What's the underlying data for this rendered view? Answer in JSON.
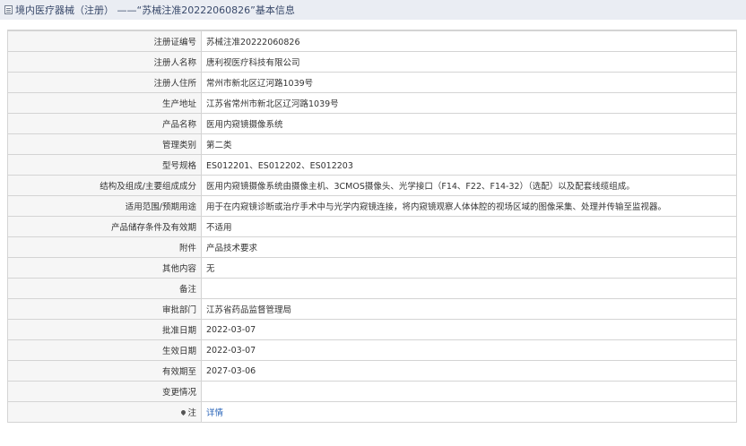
{
  "header": {
    "title": "境内医疗器械（注册） ——“苏械注准20222060826”基本信息"
  },
  "rows": [
    {
      "label": "注册证编号",
      "value": "苏械注准20222060826"
    },
    {
      "label": "注册人名称",
      "value": "唐利视医疗科技有限公司"
    },
    {
      "label": "注册人住所",
      "value": "常州市新北区辽河路1039号"
    },
    {
      "label": "生产地址",
      "value": "江苏省常州市新北区辽河路1039号"
    },
    {
      "label": "产品名称",
      "value": "医用内窥镜摄像系统"
    },
    {
      "label": "管理类别",
      "value": "第二类"
    },
    {
      "label": "型号规格",
      "value": "ES012201、ES012202、ES012203"
    },
    {
      "label": "结构及组成/主要组成成分",
      "value": "医用内窥镜摄像系统由摄像主机、3CMOS摄像头、光学接口（F14、F22、F14-32）（选配）以及配套线缆组成。"
    },
    {
      "label": "适用范围/预期用途",
      "value": "用于在内窥镜诊断或治疗手术中与光学内窥镜连接，将内窥镜观察人体体腔的视场区域的图像采集、处理并传输至监视器。"
    },
    {
      "label": "产品储存条件及有效期",
      "value": "不适用"
    },
    {
      "label": "附件",
      "value": "产品技术要求"
    },
    {
      "label": "其他内容",
      "value": "无"
    },
    {
      "label": "备注",
      "value": ""
    },
    {
      "label": "审批部门",
      "value": "江苏省药品监督管理局"
    },
    {
      "label": "批准日期",
      "value": "2022-03-07"
    },
    {
      "label": "生效日期",
      "value": "2022-03-07"
    },
    {
      "label": "有效期至",
      "value": "2027-03-06"
    },
    {
      "label": "变更情况",
      "value": ""
    }
  ],
  "note_row": {
    "label": "注",
    "icon": "pin-icon",
    "link_text": "详情"
  },
  "colors": {
    "header_bg": "#eaedf3",
    "label_bg": "#f6f6f6",
    "border": "#d4d4d4",
    "link": "#2a64b8"
  }
}
